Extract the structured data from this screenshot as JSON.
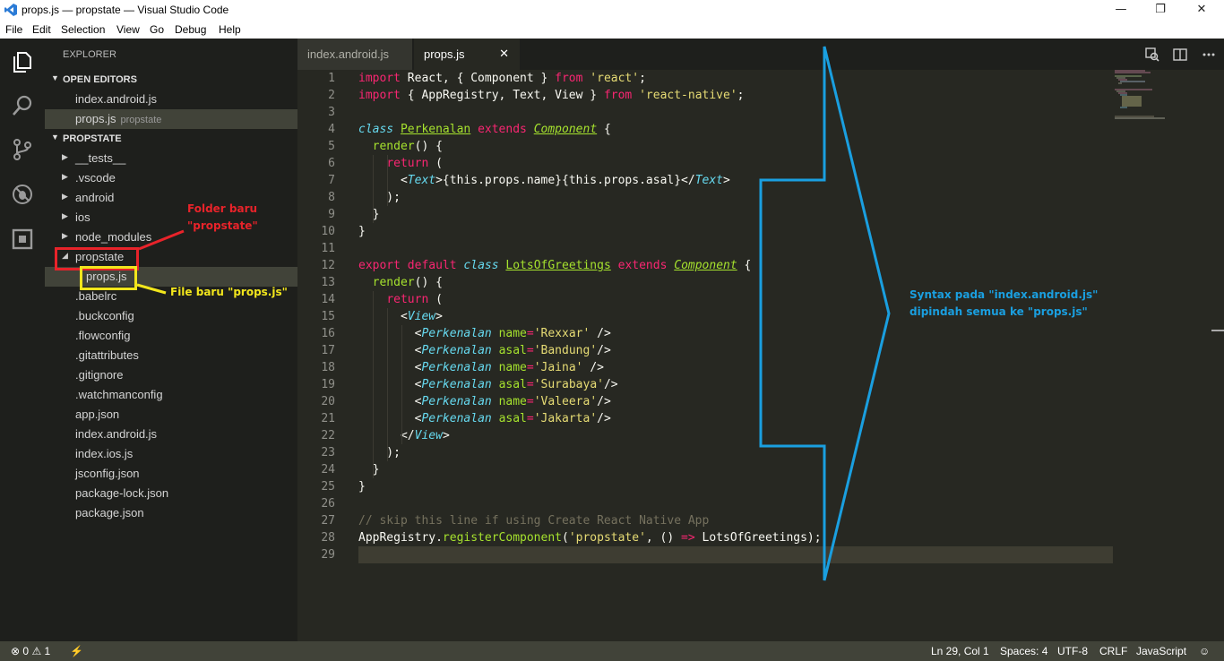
{
  "window": {
    "title": "props.js — propstate — Visual Studio Code",
    "minimize": "—",
    "maximize": "❐",
    "close": "✕"
  },
  "menu": [
    "File",
    "Edit",
    "Selection",
    "View",
    "Go",
    "Debug",
    "Help"
  ],
  "sidebar": {
    "header": "EXPLORER",
    "open_editors_label": "OPEN EDITORS",
    "open_editors": [
      {
        "name": "index.android.js",
        "desc": ""
      },
      {
        "name": "props.js",
        "desc": "propstate"
      }
    ],
    "project_label": "PROPSTATE",
    "tree": [
      {
        "name": "__tests__",
        "type": "folder-collapsed"
      },
      {
        "name": ".vscode",
        "type": "folder-collapsed"
      },
      {
        "name": "android",
        "type": "folder-collapsed"
      },
      {
        "name": "ios",
        "type": "folder-collapsed"
      },
      {
        "name": "node_modules",
        "type": "folder-collapsed"
      },
      {
        "name": "propstate",
        "type": "folder-expanded"
      },
      {
        "name": "props.js",
        "type": "file-nested"
      },
      {
        "name": ".babelrc",
        "type": "file"
      },
      {
        "name": ".buckconfig",
        "type": "file"
      },
      {
        "name": ".flowconfig",
        "type": "file"
      },
      {
        "name": ".gitattributes",
        "type": "file"
      },
      {
        "name": ".gitignore",
        "type": "file"
      },
      {
        "name": ".watchmanconfig",
        "type": "file"
      },
      {
        "name": "app.json",
        "type": "file"
      },
      {
        "name": "index.android.js",
        "type": "file"
      },
      {
        "name": "index.ios.js",
        "type": "file"
      },
      {
        "name": "jsconfig.json",
        "type": "file"
      },
      {
        "name": "package-lock.json",
        "type": "file"
      },
      {
        "name": "package.json",
        "type": "file"
      }
    ]
  },
  "tabs": [
    {
      "label": "index.android.js",
      "active": false
    },
    {
      "label": "props.js",
      "active": true,
      "close": "✕"
    }
  ],
  "editor": {
    "line_numbers": [
      "1",
      "2",
      "3",
      "4",
      "5",
      "6",
      "7",
      "8",
      "9",
      "10",
      "11",
      "12",
      "13",
      "14",
      "15",
      "16",
      "17",
      "18",
      "19",
      "20",
      "21",
      "22",
      "23",
      "24",
      "25",
      "26",
      "27",
      "28",
      "29"
    ],
    "current_line": 29,
    "lines": [
      [
        [
          "k",
          "import"
        ],
        [
          "p",
          " React, { Component } "
        ],
        [
          "k",
          "from"
        ],
        [
          "p",
          " "
        ],
        [
          "s",
          "'react'"
        ],
        [
          "p",
          ";"
        ]
      ],
      [
        [
          "k",
          "import"
        ],
        [
          "p",
          " { AppRegistry, Text, View } "
        ],
        [
          "k",
          "from"
        ],
        [
          "p",
          " "
        ],
        [
          "s",
          "'react-native'"
        ],
        [
          "p",
          ";"
        ]
      ],
      [],
      [
        [
          "it",
          "class"
        ],
        [
          "p",
          " "
        ],
        [
          "cls",
          "Perkenalan"
        ],
        [
          "p",
          " "
        ],
        [
          "k",
          "extends"
        ],
        [
          "p",
          " "
        ],
        [
          "ui",
          "Component"
        ],
        [
          "p",
          " {"
        ]
      ],
      [
        [
          "p",
          "  "
        ],
        [
          "f",
          "render"
        ],
        [
          "p",
          "() {"
        ]
      ],
      [
        [
          "p",
          "    "
        ],
        [
          "k",
          "return"
        ],
        [
          "p",
          " ("
        ]
      ],
      [
        [
          "p",
          "      <"
        ],
        [
          "it",
          "Text"
        ],
        [
          "p",
          ">{this.props.name}{this.props.asal}</"
        ],
        [
          "it",
          "Text"
        ],
        [
          "p",
          ">"
        ]
      ],
      [
        [
          "p",
          "    );"
        ]
      ],
      [
        [
          "p",
          "  }"
        ]
      ],
      [
        [
          "p",
          "}"
        ]
      ],
      [],
      [
        [
          "k",
          "export"
        ],
        [
          "p",
          " "
        ],
        [
          "k",
          "default"
        ],
        [
          "p",
          " "
        ],
        [
          "it",
          "class"
        ],
        [
          "p",
          " "
        ],
        [
          "cls",
          "LotsOfGreetings"
        ],
        [
          "p",
          " "
        ],
        [
          "k",
          "extends"
        ],
        [
          "p",
          " "
        ],
        [
          "ui",
          "Component"
        ],
        [
          "p",
          " {"
        ]
      ],
      [
        [
          "p",
          "  "
        ],
        [
          "f",
          "render"
        ],
        [
          "p",
          "() {"
        ]
      ],
      [
        [
          "p",
          "    "
        ],
        [
          "k",
          "return"
        ],
        [
          "p",
          " ("
        ]
      ],
      [
        [
          "p",
          "      <"
        ],
        [
          "it",
          "View"
        ],
        [
          "p",
          ">"
        ]
      ],
      [
        [
          "p",
          "        <"
        ],
        [
          "it",
          "Perkenalan"
        ],
        [
          "p",
          " "
        ],
        [
          "a",
          "name"
        ],
        [
          "k",
          "="
        ],
        [
          "s",
          "'Rexxar'"
        ],
        [
          "p",
          " />"
        ]
      ],
      [
        [
          "p",
          "        <"
        ],
        [
          "it",
          "Perkenalan"
        ],
        [
          "p",
          " "
        ],
        [
          "a",
          "asal"
        ],
        [
          "k",
          "="
        ],
        [
          "s",
          "'Bandung'"
        ],
        [
          "p",
          "/>"
        ]
      ],
      [
        [
          "p",
          "        <"
        ],
        [
          "it",
          "Perkenalan"
        ],
        [
          "p",
          " "
        ],
        [
          "a",
          "name"
        ],
        [
          "k",
          "="
        ],
        [
          "s",
          "'Jaina'"
        ],
        [
          "p",
          " />"
        ]
      ],
      [
        [
          "p",
          "        <"
        ],
        [
          "it",
          "Perkenalan"
        ],
        [
          "p",
          " "
        ],
        [
          "a",
          "asal"
        ],
        [
          "k",
          "="
        ],
        [
          "s",
          "'Surabaya'"
        ],
        [
          "p",
          "/>"
        ]
      ],
      [
        [
          "p",
          "        <"
        ],
        [
          "it",
          "Perkenalan"
        ],
        [
          "p",
          " "
        ],
        [
          "a",
          "name"
        ],
        [
          "k",
          "="
        ],
        [
          "s",
          "'Valeera'"
        ],
        [
          "p",
          "/>"
        ]
      ],
      [
        [
          "p",
          "        <"
        ],
        [
          "it",
          "Perkenalan"
        ],
        [
          "p",
          " "
        ],
        [
          "a",
          "asal"
        ],
        [
          "k",
          "="
        ],
        [
          "s",
          "'Jakarta'"
        ],
        [
          "p",
          "/>"
        ]
      ],
      [
        [
          "p",
          "      </"
        ],
        [
          "it",
          "View"
        ],
        [
          "p",
          ">"
        ]
      ],
      [
        [
          "p",
          "    );"
        ]
      ],
      [
        [
          "p",
          "  }"
        ]
      ],
      [
        [
          "p",
          "}"
        ]
      ],
      [],
      [
        [
          "cm",
          "// skip this line if using Create React Native App"
        ]
      ],
      [
        [
          "p",
          "AppRegistry."
        ],
        [
          "f",
          "registerComponent"
        ],
        [
          "p",
          "("
        ],
        [
          "s",
          "'propstate'"
        ],
        [
          "p",
          ", () "
        ],
        [
          "k",
          "=>"
        ],
        [
          "p",
          " LotsOfGreetings);"
        ]
      ],
      []
    ]
  },
  "annotations": {
    "folder_note_1": "Folder baru",
    "folder_note_2": "\"propstate\"",
    "file_note": "File baru \"props.js\"",
    "syntax_note_1": "Syntax pada \"index.android.js\"",
    "syntax_note_2": "dipindah semua ke \"props.js\"",
    "colors": {
      "red": "#e8232a",
      "yellow": "#f2e61c",
      "blue": "#1a9fe0"
    }
  },
  "status": {
    "errors": "0",
    "warnings": "1",
    "position": "Ln 29, Col 1",
    "spaces": "Spaces: 4",
    "encoding": "UTF-8",
    "eol": "CRLF",
    "language": "JavaScript"
  }
}
